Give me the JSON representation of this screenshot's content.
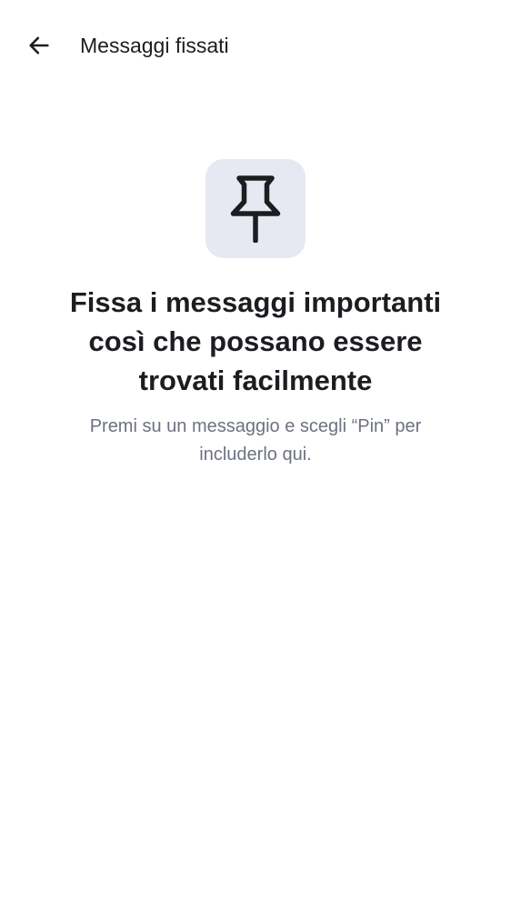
{
  "app_bar": {
    "back_icon": "arrow-left-icon",
    "title": "Messaggi fissati"
  },
  "empty_state": {
    "icon": "pin-icon",
    "headline": "Fissa i messaggi importanti così che possano essere trovati facilmente",
    "hint": "Premi su un messaggio e scegli “Pin” per includerlo qui."
  },
  "colors": {
    "text_primary": "#1c1d21",
    "text_secondary": "#6c7280",
    "icon_badge_background": "#e6e9f1",
    "background": "#ffffff"
  }
}
